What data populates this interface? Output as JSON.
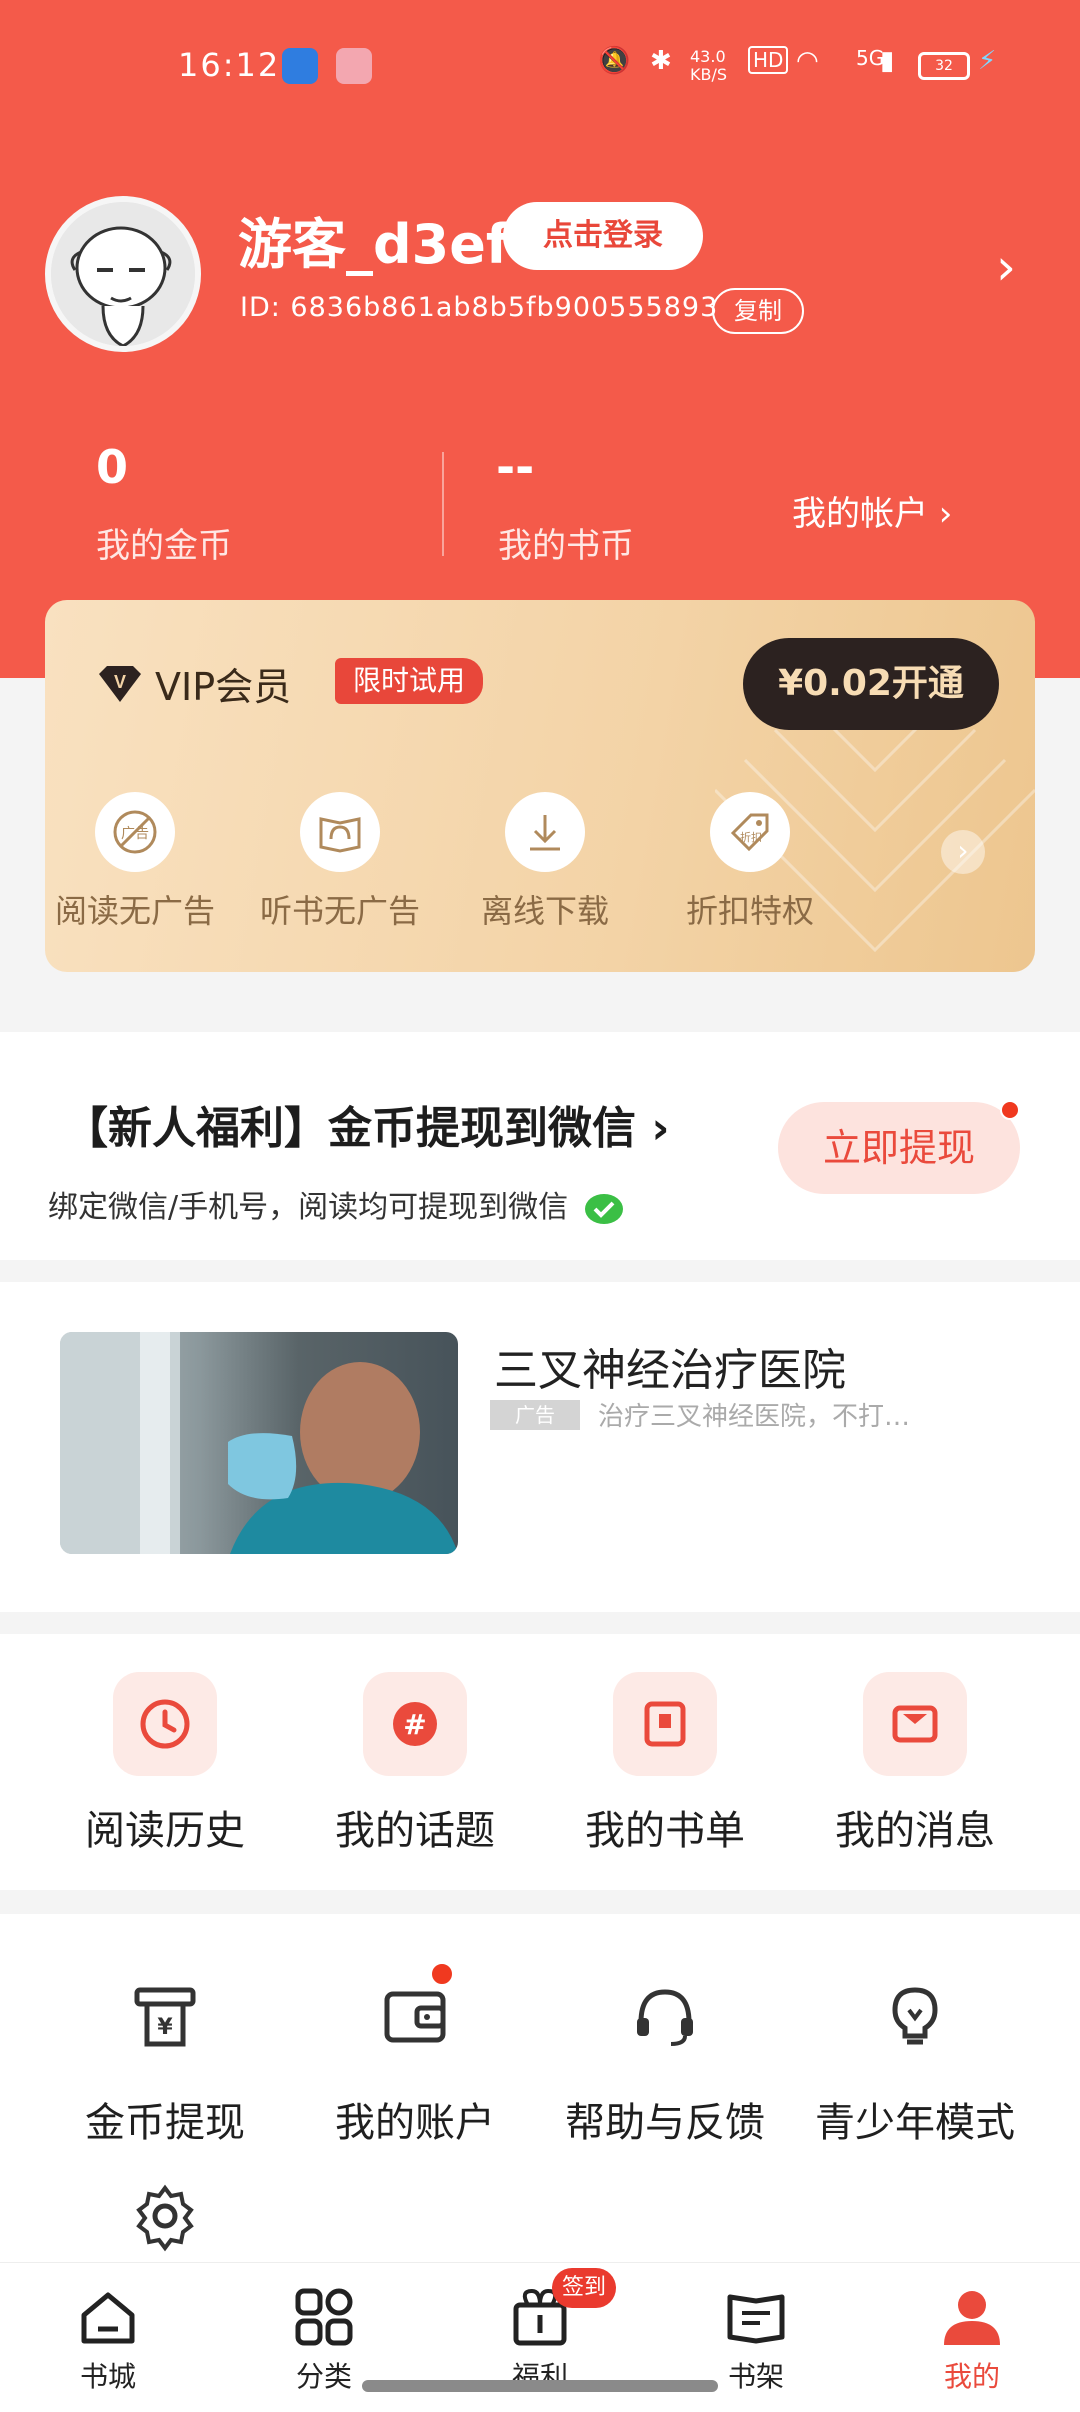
{
  "status_bar": {
    "time": "16:12",
    "net_speed": "43.0 KB/S",
    "hd": "HD",
    "signal": "5G",
    "battery": "32"
  },
  "profile": {
    "username": "游客_d3ef",
    "login_label": "点击登录",
    "user_id": "ID: 6836b861ab8b5fb900555893",
    "copy_label": "复制"
  },
  "stats": {
    "coins_value": "0",
    "coins_label": "我的金币",
    "book_coins_value": "--",
    "book_coins_label": "我的书币",
    "account_label": "我的帐户 ›"
  },
  "vip": {
    "title": "VIP会员",
    "tag": "限时试用",
    "open_label": "¥0.02开通",
    "features": [
      {
        "label": "阅读无广告",
        "icon": "no-ads-icon"
      },
      {
        "label": "听书无广告",
        "icon": "audiobook-icon"
      },
      {
        "label": "离线下载",
        "icon": "download-icon"
      },
      {
        "label": "折扣特权",
        "icon": "discount-tag-icon"
      }
    ]
  },
  "welfare": {
    "title": "【新人福利】金币提现到微信 ›",
    "subtitle": "绑定微信/手机号，阅读均可提现到微信",
    "button": "立即提现"
  },
  "ad": {
    "title": "三叉神经治疗医院",
    "tag": "广告",
    "desc": "治疗三叉神经医院，不打…"
  },
  "quick_menu": [
    {
      "label": "阅读历史",
      "icon": "clock-icon"
    },
    {
      "label": "我的话题",
      "icon": "hashtag-icon"
    },
    {
      "label": "我的书单",
      "icon": "bookmark-icon"
    },
    {
      "label": "我的消息",
      "icon": "message-icon"
    }
  ],
  "tools": [
    {
      "label": "金币提现",
      "icon": "withdraw-icon"
    },
    {
      "label": "我的账户",
      "icon": "wallet-icon"
    },
    {
      "label": "帮助与反馈",
      "icon": "headset-icon"
    },
    {
      "label": "青少年模式",
      "icon": "bulb-icon"
    }
  ],
  "nav": {
    "items": [
      {
        "label": "书城",
        "icon": "home-icon"
      },
      {
        "label": "分类",
        "icon": "grid-icon"
      },
      {
        "label": "福利",
        "icon": "gift-icon"
      },
      {
        "label": "书架",
        "icon": "bookshelf-icon"
      },
      {
        "label": "我的",
        "icon": "profile-icon"
      }
    ],
    "badge": "签到"
  },
  "colors": {
    "brand_red": "#f45a4a",
    "accent_red": "#ea4a3c",
    "vip_gold": "#f3d3a6"
  }
}
